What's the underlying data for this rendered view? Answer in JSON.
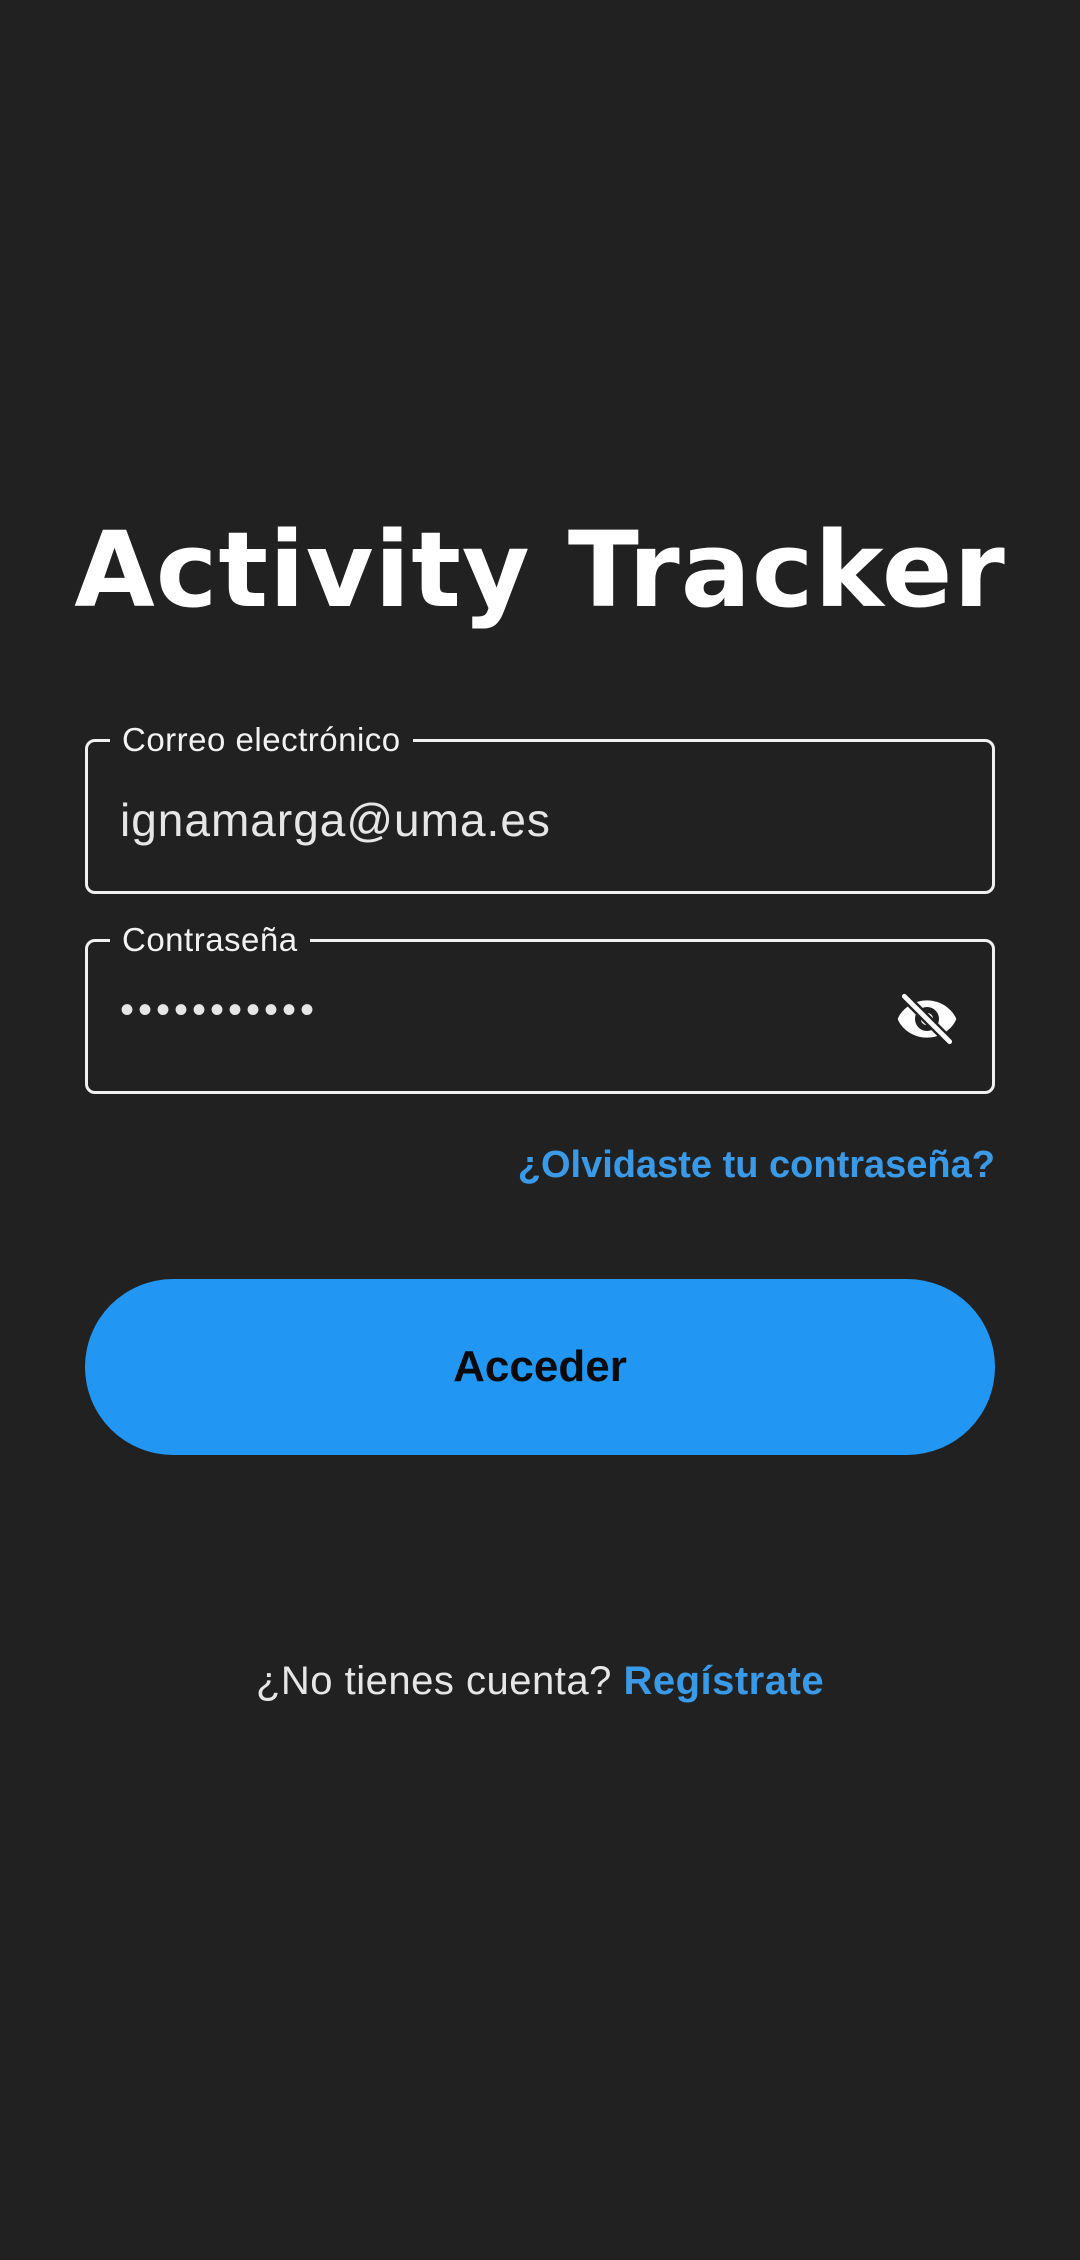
{
  "app": {
    "title": "Activity Tracker"
  },
  "form": {
    "email": {
      "label": "Correo electrónico",
      "value": "ignamarga@uma.es"
    },
    "password": {
      "label": "Contraseña",
      "value": "•••••••••••",
      "toggle_icon": "eye-off-icon"
    },
    "forgot_password": "¿Olvidaste tu contraseña?",
    "submit_label": "Acceder"
  },
  "signup": {
    "prompt": "¿No tienes cuenta? ",
    "link": "Regístrate"
  },
  "colors": {
    "background": "#212121",
    "accent": "#2196f3",
    "link": "#3a9ae8",
    "field_border": "#f0f0f0"
  }
}
